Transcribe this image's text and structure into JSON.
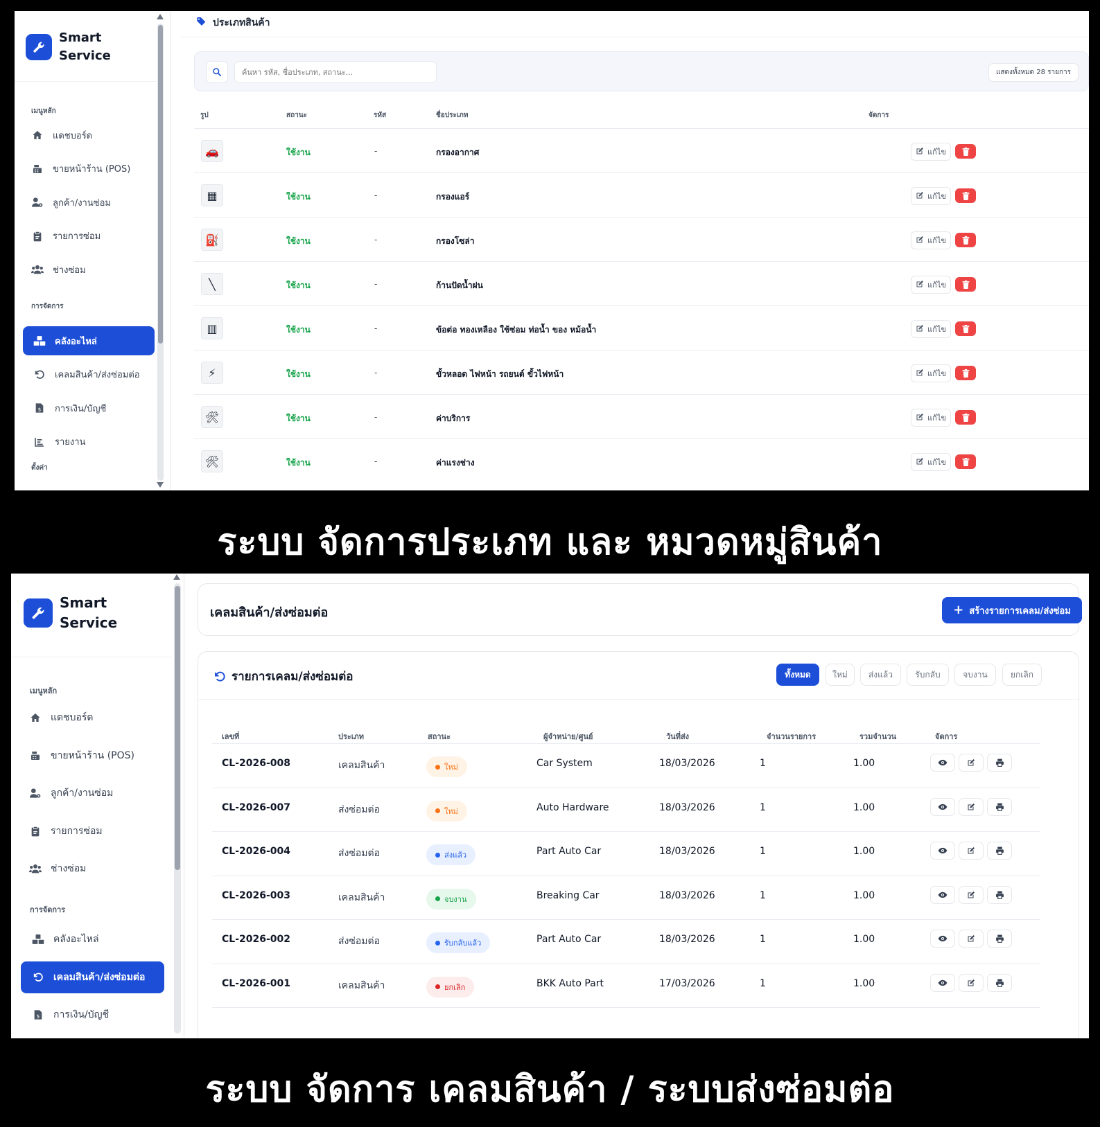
{
  "shot1": {
    "brand": {
      "line1": "Smart",
      "line2": "Service"
    },
    "sidebar": {
      "section_main": "เมนูหลัก",
      "items_main": [
        {
          "label": "แดชบอร์ด",
          "icon": "home-icon"
        },
        {
          "label": "ขายหน้าร้าน (POS)",
          "icon": "cash-register-icon"
        },
        {
          "label": "ลูกค้า/งานซ่อม",
          "icon": "user-gear-icon"
        },
        {
          "label": "รายการซ่อม",
          "icon": "clipboard-icon"
        },
        {
          "label": "ช่างซ่อม",
          "icon": "users-icon"
        }
      ],
      "section_manage": "การจัดการ",
      "items_manage": [
        {
          "label": "คลังอะไหล่",
          "icon": "boxes-icon",
          "active": true
        },
        {
          "label": "เคลมสินค้า/ส่งซ่อมต่อ",
          "icon": "rotate-left-icon"
        },
        {
          "label": "การเงิน/บัญชี",
          "icon": "file-invoice-dollar-icon"
        },
        {
          "label": "รายงาน",
          "icon": "chart-bar-icon"
        }
      ],
      "section_settings": "ตั้งค่า"
    },
    "page_title": "ประเภทสินค้า",
    "search": {
      "placeholder": "ค้นหา รหัส, ชื่อประเภท, สถานะ..."
    },
    "count_label": "แสดงทั้งหมด 28 รายการ",
    "table": {
      "headers": [
        "รูป",
        "สถานะ",
        "รหัส",
        "ชื่อประเภท",
        "จัดการ"
      ],
      "edit_label": "แก้ไข",
      "rows": [
        {
          "status": "ใช้งาน",
          "code": "-",
          "name": "กรองอากาศ",
          "thumb": "🚗"
        },
        {
          "status": "ใช้งาน",
          "code": "-",
          "name": "กรองแอร์",
          "thumb": "▦"
        },
        {
          "status": "ใช้งาน",
          "code": "-",
          "name": "กรองโซล่า",
          "thumb": "⛽"
        },
        {
          "status": "ใช้งาน",
          "code": "-",
          "name": "ก้านปัดน้ำฝน",
          "thumb": "╲"
        },
        {
          "status": "ใช้งาน",
          "code": "-",
          "name": "ข้อต่อ ทองเหลือง ใช้ซ่อม ท่อน้ำ ของ หม้อน้ำ",
          "thumb": "▥"
        },
        {
          "status": "ใช้งาน",
          "code": "-",
          "name": "ขั้วหลอด ไฟหน้า รถยนต์ ขั้วไฟหน้า",
          "thumb": "⚡"
        },
        {
          "status": "ใช้งาน",
          "code": "-",
          "name": "ค่าบริการ",
          "thumb": "🛠"
        },
        {
          "status": "ใช้งาน",
          "code": "-",
          "name": "ค่าแรงช่าง",
          "thumb": "🛠"
        }
      ]
    }
  },
  "caption1": "ระบบ จัดการประเภท และ หมวดหมู่สินค้า",
  "shot2": {
    "brand": {
      "line1": "Smart",
      "line2": "Service"
    },
    "sidebar": {
      "section_main": "เมนูหลัก",
      "items_main": [
        {
          "label": "แดชบอร์ด",
          "icon": "home-icon"
        },
        {
          "label": "ขายหน้าร้าน (POS)",
          "icon": "cash-register-icon"
        },
        {
          "label": "ลูกค้า/งานซ่อม",
          "icon": "user-gear-icon"
        },
        {
          "label": "รายการซ่อม",
          "icon": "clipboard-icon"
        },
        {
          "label": "ช่างซ่อม",
          "icon": "users-icon"
        }
      ],
      "section_manage": "การจัดการ",
      "items_manage": [
        {
          "label": "คลังอะไหล่",
          "icon": "boxes-icon"
        },
        {
          "label": "เคลมสินค้า/ส่งซ่อมต่อ",
          "icon": "rotate-left-icon",
          "active": true
        },
        {
          "label": "การเงิน/บัญชี",
          "icon": "file-invoice-dollar-icon"
        }
      ]
    },
    "page_title": "เคลมสินค้า/ส่งซ่อมต่อ",
    "create_button": "สร้างรายการเคลม/ส่งซ่อม",
    "list_title": "รายการเคลม/ส่งซ่อมต่อ",
    "filters": [
      "ทั้งหมด",
      "ใหม่",
      "ส่งแล้ว",
      "รับกลับ",
      "จบงาน",
      "ยกเลิก"
    ],
    "active_filter": "ทั้งหมด",
    "table": {
      "headers": [
        "เลขที่",
        "ประเภท",
        "สถานะ",
        "ผู้จำหน่าย/ศูนย์",
        "วันที่ส่ง",
        "จำนวนรายการ",
        "รวมจำนวน",
        "จัดการ"
      ],
      "rows": [
        {
          "no": "CL-2026-008",
          "type": "เคลมสินค้า",
          "status": "ใหม่",
          "status_color": "#f97316",
          "status_bg": "#fff3e6",
          "vendor": "Car System",
          "date": "18/03/2026",
          "items": "1",
          "total": "1.00"
        },
        {
          "no": "CL-2026-007",
          "type": "ส่งซ่อมต่อ",
          "status": "ใหม่",
          "status_color": "#f97316",
          "status_bg": "#fff3e6",
          "vendor": "Auto Hardware",
          "date": "18/03/2026",
          "items": "1",
          "total": "1.00"
        },
        {
          "no": "CL-2026-004",
          "type": "ส่งซ่อมต่อ",
          "status": "ส่งแล้ว",
          "status_color": "#2563eb",
          "status_bg": "#e8efff",
          "vendor": "Part Auto Car",
          "date": "18/03/2026",
          "items": "1",
          "total": "1.00"
        },
        {
          "no": "CL-2026-003",
          "type": "เคลมสินค้า",
          "status": "จบงาน",
          "status_color": "#16a34a",
          "status_bg": "#e6f7ec",
          "vendor": "Breaking Car",
          "date": "18/03/2026",
          "items": "1",
          "total": "1.00"
        },
        {
          "no": "CL-2026-002",
          "type": "ส่งซ่อมต่อ",
          "status": "รับกลับแล้ว",
          "status_color": "#2563eb",
          "status_bg": "#e8efff",
          "vendor": "Part Auto Car",
          "date": "18/03/2026",
          "items": "1",
          "total": "1.00"
        },
        {
          "no": "CL-2026-001",
          "type": "เคลมสินค้า",
          "status": "ยกเลิก",
          "status_color": "#dc2626",
          "status_bg": "#fdecec",
          "vendor": "BKK Auto Part",
          "date": "17/03/2026",
          "items": "1",
          "total": "1.00"
        }
      ]
    }
  },
  "caption2": "ระบบ จัดการ เคลมสินค้า / ระบบส่งซ่อมต่อ",
  "colors": {
    "primary": "#1d4ed8",
    "danger": "#ef4444",
    "success": "#16a34a"
  }
}
